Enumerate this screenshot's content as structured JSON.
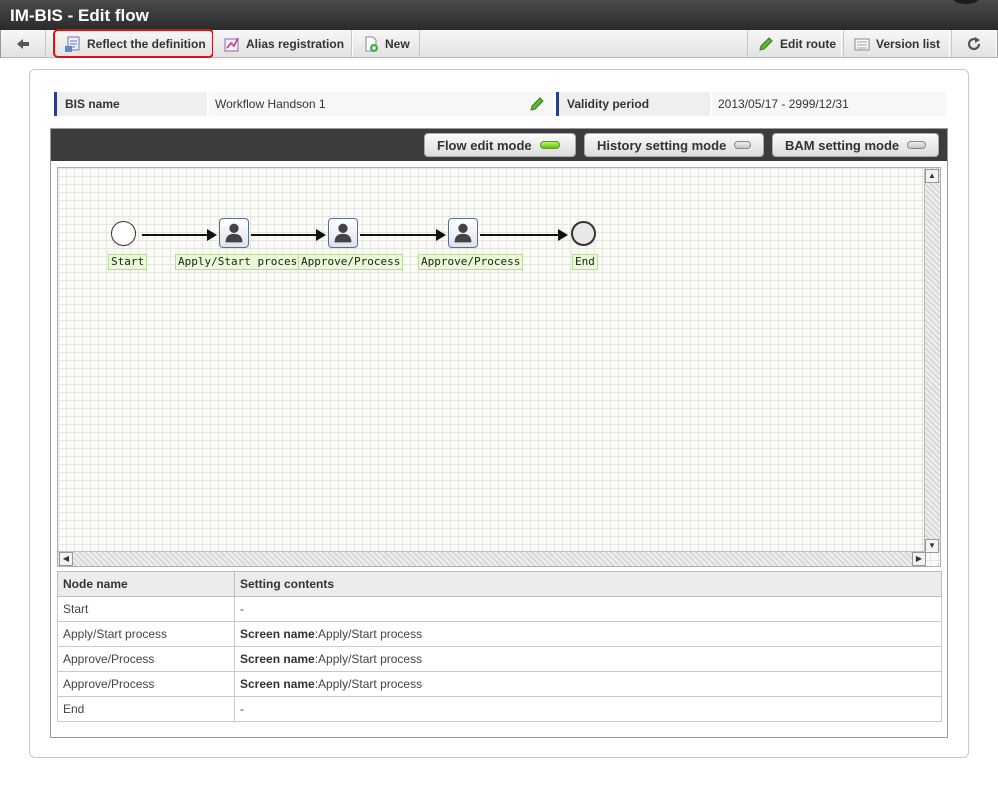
{
  "window": {
    "title": "IM-BIS - Edit flow"
  },
  "toolbar": {
    "reflect_label": "Reflect the definition",
    "alias_label": "Alias registration",
    "new_label": "New",
    "edit_route_label": "Edit route",
    "version_list_label": "Version list"
  },
  "info": {
    "bis_name_label": "BIS name",
    "bis_name_value": "Workflow Handson 1",
    "validity_label": "Validity period",
    "validity_value": "2013/05/17 - 2999/12/31"
  },
  "modes": {
    "flow_edit": "Flow edit mode",
    "history": "History setting mode",
    "bam": "BAM setting mode",
    "active": "flow_edit"
  },
  "flow": {
    "nodes": [
      {
        "label": "Start",
        "type": "start"
      },
      {
        "label": "Apply/Start process",
        "type": "user"
      },
      {
        "label": "Approve/Process",
        "type": "user"
      },
      {
        "label": "Approve/Process",
        "type": "user"
      },
      {
        "label": "End",
        "type": "end"
      }
    ]
  },
  "table": {
    "headers": [
      "Node name",
      "Setting contents"
    ],
    "rows": [
      {
        "node": "Start",
        "key": "",
        "value": "-"
      },
      {
        "node": "Apply/Start process",
        "key": "Screen name",
        "value": ":Apply/Start process"
      },
      {
        "node": "Approve/Process",
        "key": "Screen name",
        "value": ":Apply/Start process"
      },
      {
        "node": "Approve/Process",
        "key": "Screen name",
        "value": ":Apply/Start process"
      },
      {
        "node": "End",
        "key": "",
        "value": "-"
      }
    ]
  },
  "colors": {
    "highlight": "#dd1111",
    "led_on": "#63c21a",
    "label_accent": "#2a3f8a"
  },
  "icons": [
    "back-arrow-icon",
    "reflect-icon",
    "alias-icon",
    "new-document-icon",
    "pencil-icon",
    "list-icon",
    "refresh-icon",
    "user-icon"
  ]
}
